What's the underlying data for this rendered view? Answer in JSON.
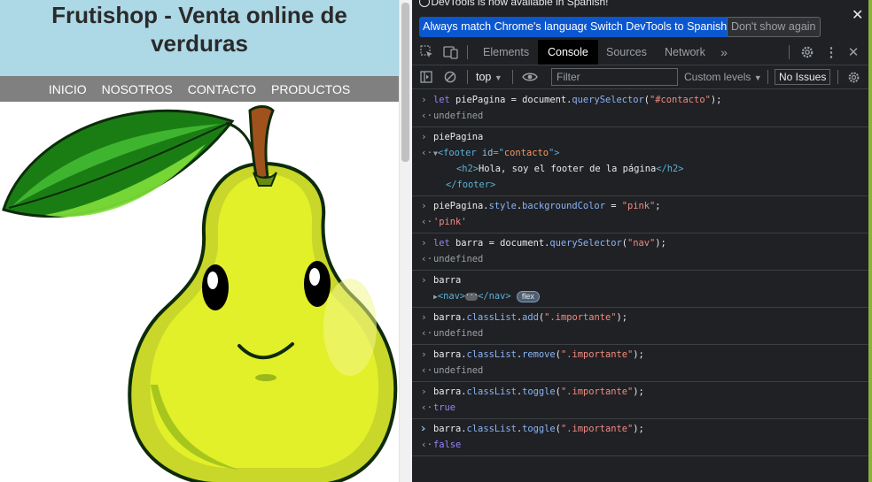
{
  "page": {
    "title": "Frutishop - Venta online de verduras",
    "nav": [
      "INICIO",
      "NOSOTROS",
      "CONTACTO",
      "PRODUCTOS"
    ]
  },
  "devtools": {
    "infobar": {
      "message": "DevTools is now available in Spanish!",
      "match_button": "Always match Chrome's language",
      "switch_button": "Switch DevTools to Spanish",
      "dont_show_button": "Don't show again"
    },
    "tabs": [
      "Elements",
      "Console",
      "Sources",
      "Network"
    ],
    "toolbar": {
      "context": "top",
      "filter_placeholder": "Filter",
      "levels": "Custom levels",
      "issues": "No Issues"
    }
  },
  "console": {
    "e1": {
      "kw": "let",
      "var": " piePagina = document.",
      "fn": "querySelector",
      "open": "(",
      "str": "\"#contacto\"",
      "close": ");",
      "result": "undefined"
    },
    "e2": {
      "input": "piePagina",
      "l1_tag_open": "<footer",
      "l1_attr": " id",
      "l1_eq": "=\"",
      "l1_val": "contacto",
      "l1_end": "\">",
      "l2_h2_open": "<h2>",
      "l2_text": "Hola, soy el footer de la página",
      "l2_h2_close": "</h2>",
      "l3": "</footer>"
    },
    "e3": {
      "var": "piePagina.",
      "prop": "style",
      "dot": ".",
      "prop2": "backgroundColor",
      "eq": " = ",
      "str": "\"pink\"",
      "end": ";",
      "result": "'pink'"
    },
    "e4": {
      "kw": "let",
      "var": " barra = document.",
      "fn": "querySelector",
      "open": "(",
      "str": "\"nav\"",
      "close": ");",
      "result": "undefined"
    },
    "e5": {
      "input": "barra",
      "tag_open": "<nav>",
      "tag_close": "</nav>",
      "badge": "flex"
    },
    "e6": {
      "var": "barra.",
      "p1": "classList",
      "dot": ".",
      "p2": "add",
      "open": "(",
      "str": "\".importante\"",
      "close": ");",
      "result": "undefined"
    },
    "e7": {
      "var": "barra.",
      "p1": "classList",
      "dot": ".",
      "p2": "remove",
      "open": "(",
      "str": "\".importante\"",
      "close": ");",
      "result": "undefined"
    },
    "e8": {
      "var": "barra.",
      "p1": "classList",
      "dot": ".",
      "p2": "toggle",
      "open": "(",
      "str": "\".importante\"",
      "close": ");",
      "result": "true"
    },
    "e9": {
      "var": "barra.",
      "p1": "classList",
      "dot": ".",
      "p2": "toggle",
      "open": "(",
      "str": "\".importante\"",
      "close": ");",
      "result": "false"
    }
  }
}
